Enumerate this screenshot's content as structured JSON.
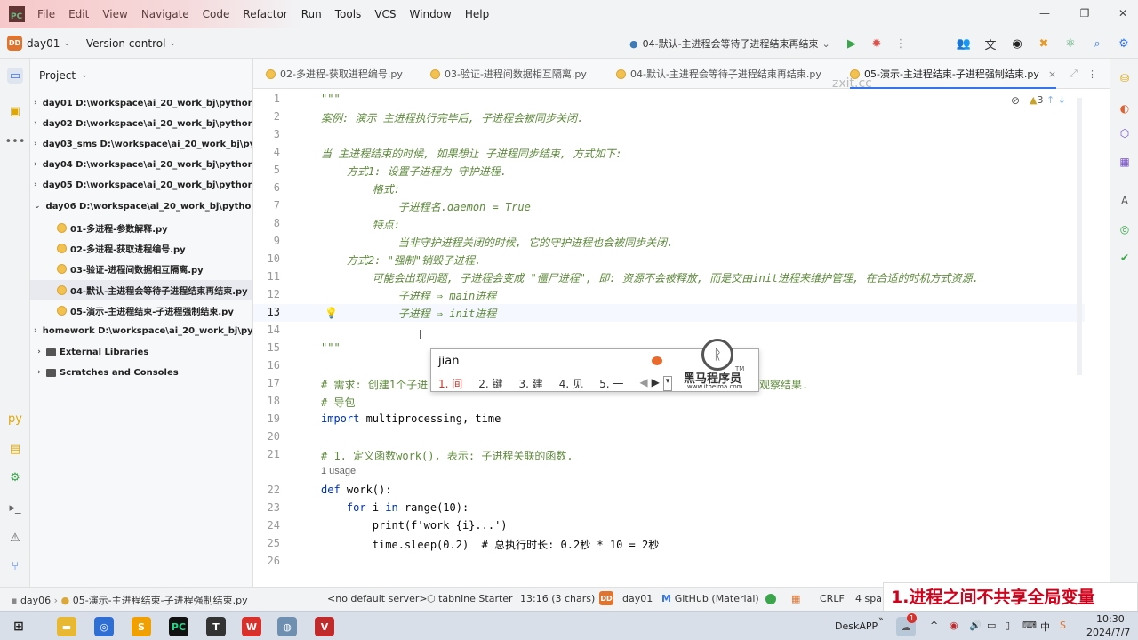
{
  "menubar": {
    "items": [
      "File",
      "Edit",
      "View",
      "Navigate",
      "Code",
      "Refactor",
      "Run",
      "Tools",
      "VCS",
      "Window",
      "Help"
    ]
  },
  "toolbar": {
    "project_badge": "DD",
    "project_name": "day01",
    "vcs_label": "Version control",
    "run_config": "04-默认-主进程会等待子进程结束再结束"
  },
  "project_panel": {
    "title": "Project",
    "rows": [
      {
        "label": "day01  D:\\workspace\\ai_20_work_bj\\pythonProje",
        "type": "folder",
        "arrow": "▶"
      },
      {
        "label": "day02  D:\\workspace\\ai_20_work_bj\\pythonProje",
        "type": "folder",
        "arrow": "▶"
      },
      {
        "label": "day03_sms  D:\\workspace\\ai_20_work_bj\\python",
        "type": "folder",
        "arrow": "▶"
      },
      {
        "label": "day04  D:\\workspace\\ai_20_work_bj\\pythonProje",
        "type": "folder",
        "arrow": "▶"
      },
      {
        "label": "day05  D:\\workspace\\ai_20_work_bj\\pythonProje",
        "type": "folder",
        "arrow": "▶"
      },
      {
        "label": "day06  D:\\workspace\\ai_20_work_bj\\pythonProje",
        "type": "folder",
        "arrow": "▼"
      },
      {
        "label": "01-多进程-参数解释.py",
        "type": "file"
      },
      {
        "label": "02-多进程-获取进程编号.py",
        "type": "file"
      },
      {
        "label": "03-验证-进程间数据相互隔离.py",
        "type": "file"
      },
      {
        "label": "04-默认-主进程会等待子进程结束再结束.py",
        "type": "file"
      },
      {
        "label": "05-演示-主进程结束-子进程强制结束.py",
        "type": "file"
      },
      {
        "label": "homework  D:\\workspace\\ai_20_work_bj\\pythonF",
        "type": "folder",
        "arrow": "▶"
      },
      {
        "label": "External Libraries",
        "type": "lib",
        "arrow": "▶"
      },
      {
        "label": "Scratches and Consoles",
        "type": "scratch",
        "arrow": "▶"
      }
    ]
  },
  "tabs": [
    {
      "label": "02-多进程-获取进程编号.py"
    },
    {
      "label": "03-验证-进程间数据相互隔离.py"
    },
    {
      "label": "04-默认-主进程会等待子进程结束再结束.py"
    },
    {
      "label": "05-演示-主进程结束-子进程强制结束.py",
      "close": "×"
    }
  ],
  "watermark": "zxit.cc",
  "inspection_count": "3",
  "editor": {
    "lines": [
      {
        "n": "1",
        "text": "\"\"\""
      },
      {
        "n": "2",
        "text": "案例: 演示 主进程执行完毕后, 子进程会被同步关闭."
      },
      {
        "n": "3",
        "text": ""
      },
      {
        "n": "4",
        "text": "当 主进程结束的时候, 如果想让 子进程同步结束, 方式如下:"
      },
      {
        "n": "5",
        "text": "    方式1: 设置子进程为 守护进程."
      },
      {
        "n": "6",
        "text": "        格式:"
      },
      {
        "n": "7",
        "text": "            子进程名.daemon = True"
      },
      {
        "n": "8",
        "text": "        特点:"
      },
      {
        "n": "9",
        "text": "            当非守护进程关闭的时候, 它的守护进程也会被同步关闭."
      },
      {
        "n": "10",
        "text": "    方式2: \"强制\"销毁子进程."
      },
      {
        "n": "11",
        "text": "        可能会出现问题, 子进程会变成 \"僵尸进程\", 即: 资源不会被释放, 而是交由init进程来维护管理, 在合适的时机方式资源."
      },
      {
        "n": "12",
        "text": "            子进程 ⇒ main进程"
      },
      {
        "n": "13",
        "text": "            子进程 ⇒ init进程"
      },
      {
        "n": "14",
        "text": ""
      },
      {
        "n": "15",
        "text": "\"\"\""
      },
      {
        "n": "16",
        "text": ""
      },
      {
        "n": "17",
        "text": "# 需求: 创建1个子进"
      },
      {
        "n": "18",
        "text": "# 导包"
      },
      {
        "n": "19",
        "text": "import multiprocessing, time"
      },
      {
        "n": "20",
        "text": ""
      },
      {
        "n": "21",
        "text": "# 1. 定义函数work(), 表示: 子进程关联的函数."
      },
      {
        "n": "22",
        "text": "def work():"
      },
      {
        "n": "23",
        "text": "    for i in range(10):"
      },
      {
        "n": "24",
        "text": "        print(f'work {i}...')"
      },
      {
        "n": "25",
        "text": "        time.sleep(0.2)  # 总执行时长: 0.2秒 * 10 = 2秒"
      },
      {
        "n": "26",
        "text": ""
      }
    ],
    "usage_hint": "1 usage",
    "line17_tail": "观察结果."
  },
  "ime": {
    "input": "jian",
    "candidates": [
      "1. 间",
      "2. 键",
      "3. 建",
      "4. 见",
      "5. 一"
    ],
    "logo_text": "黑马程序员",
    "logo_url_text": "www.itheima.com",
    "tm": "TM"
  },
  "statusbar": {
    "breadcrumb_project": "day06",
    "breadcrumb_file": "05-演示-主进程结束-子进程强制结束.py",
    "server": "<no default server>",
    "tabnine": "tabnine Starter",
    "position": "13:16 (3 chars)",
    "project_badge": "DD",
    "project": "day01",
    "theme": "GitHub (Material)",
    "line_ending": "CRLF",
    "indent": "4 spa"
  },
  "caption": "1.进程之间不共享全局变量",
  "taskbar": {
    "deskapp": "DeskAPP",
    "time": "10:30",
    "date": "2024/7/7",
    "ime_label": "中",
    "notification": "1"
  }
}
